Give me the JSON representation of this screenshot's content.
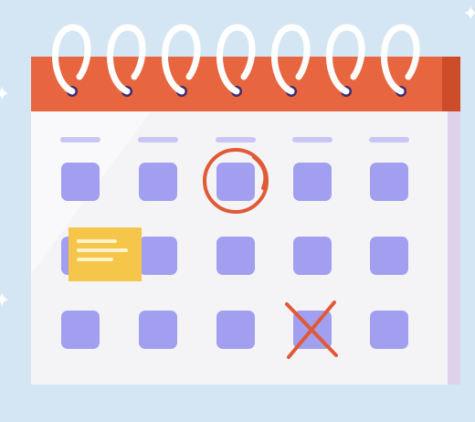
{
  "illustration": {
    "subject": "wall-calendar-with-spiral-binding",
    "colors": {
      "background": "#d4e6f3",
      "header": "#e8663f",
      "header_shade": "#cd4d2b",
      "page": "#f4f4f7",
      "page_edge": "#ddd2ea",
      "day_cell": "#a29ff0",
      "weekday_bar": "#c9c6f5",
      "ring": "#ffffff",
      "hole": "#3b2d6e",
      "mark": "#e05a36",
      "sticky_note": "#f5c64a",
      "sticky_note_lines": "#fff3c9"
    },
    "rings": 7,
    "weekday_bars": 5,
    "grid": {
      "rows": 3,
      "columns": 5
    },
    "circled_day": {
      "row": 1,
      "column": 3
    },
    "crossed_day": {
      "row": 3,
      "column": 4
    },
    "sticky_note_day": {
      "row": 2,
      "column": 1
    },
    "sparkle_icon": "sparkle-icon"
  }
}
